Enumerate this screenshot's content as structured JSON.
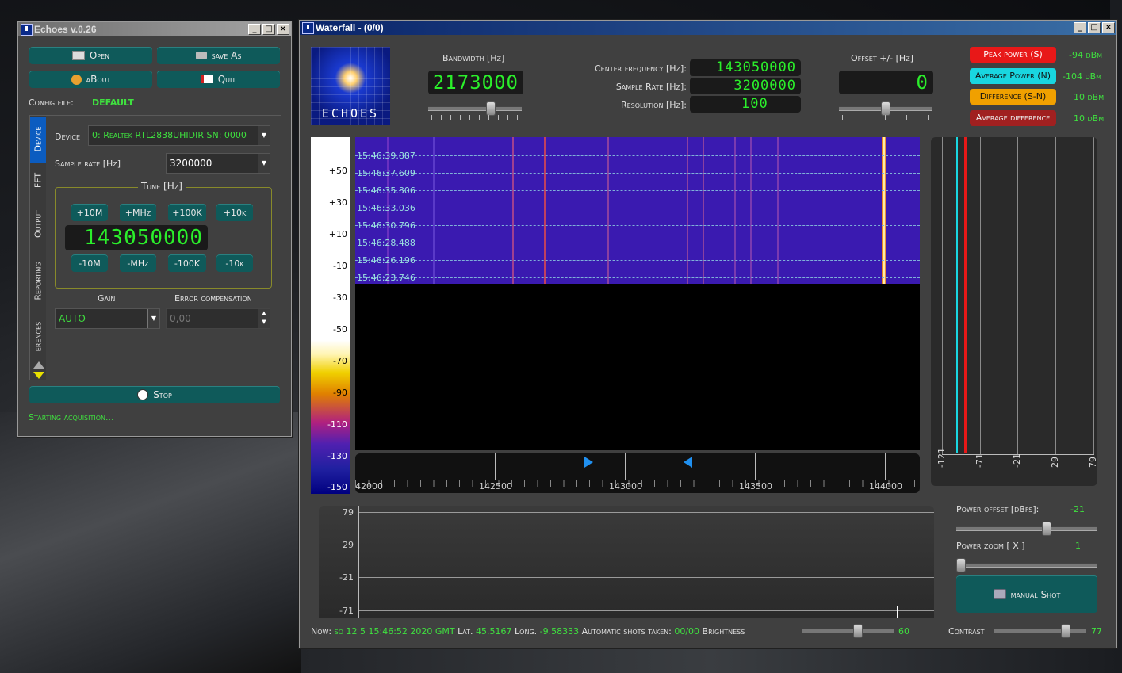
{
  "echoes_window": {
    "title": "Echoes v.0.26",
    "buttons": {
      "open": "Open",
      "save_as": "save As",
      "about": "aBout",
      "quit": "Quit",
      "stop": "Stop"
    },
    "config_label": "Config file:",
    "config_value": "DEFAULT",
    "tabs": [
      "Device",
      "FFT",
      "Output",
      "Reporting",
      "erences"
    ],
    "device_label": "Device",
    "device_value": "0: Realtek RTL2838UHIDIR  SN: 0000",
    "sample_rate_label": "Sample rate [Hz]",
    "sample_rate_value": "3200000",
    "tune_label": "Tune [Hz]",
    "tune_buttons_up": [
      "+10M",
      "+MHz",
      "+100K",
      "+10k"
    ],
    "tune_value": "143050000",
    "tune_buttons_down": [
      "-10M",
      "-MHz",
      "-100K",
      "-10k"
    ],
    "gain_label": "Gain",
    "gain_value": "AUTO",
    "error_comp_label": "Error compensation",
    "error_comp_value": "0,00",
    "status": "Starting acquisition..."
  },
  "waterfall_window": {
    "title": "Waterfall - (0/0)",
    "logo_text": "ECHOES",
    "bandwidth_label": "Bandwidth [Hz]",
    "bandwidth_value": "2173000",
    "center_freq_label": "Center frequency [Hz]:",
    "center_freq_value": "143050000",
    "sample_rate_label": "Sample Rate [Hz]:",
    "sample_rate_value": "3200000",
    "resolution_label": "Resolution [Hz]:",
    "resolution_value": "100",
    "offset_label": "Offset +/- [Hz]",
    "offset_value": "0",
    "legend": [
      {
        "label": "Peak power (S)",
        "value": "-94 dBm",
        "color": "#e81818"
      },
      {
        "label": "Average Power (N)",
        "value": "-104 dBm",
        "color": "#19d6e0"
      },
      {
        "label": "Difference (S-N)",
        "value": "10 dBm",
        "color": "#f0a000"
      },
      {
        "label": "Average difference",
        "value": "10 dBm",
        "color": "#a02020"
      }
    ],
    "color_scale": [
      "+50",
      "+30",
      "+10",
      "-10",
      "-30",
      "-50",
      "-70",
      "-90",
      "-110",
      "-130",
      "-150"
    ],
    "timestamps": [
      "15:46:39.887",
      "15:46:37.609",
      "15:46:35.306",
      "15:46:33.036",
      "15:46:30.796",
      "15:46:28.488",
      "15:46:26.196",
      "15:46:23.746"
    ],
    "freq_axis": [
      "42000",
      "142500",
      "143000",
      "143500",
      "144000"
    ],
    "power_axis": [
      "-121",
      "-71",
      "-21",
      "29",
      "79"
    ],
    "history_axis": [
      "79",
      "29",
      "-21",
      "-71"
    ],
    "power_offset_label": "Power offset [dBfs]:",
    "power_offset_value": "-21",
    "power_zoom_label": "Power zoom  [ X ]",
    "power_zoom_value": "1",
    "manual_shot_label": "manual Shot",
    "status_now_label": "Now:",
    "status_now_value": "so 12 5 15:46:52 2020 GMT",
    "lat_label": "Lat.",
    "lat_value": "45.5167",
    "long_label": "Long.",
    "long_value": "-9.58333",
    "shots_label": "Automatic shots taken:",
    "shots_value": "00/00",
    "brightness_label": "Brightness",
    "brightness_value": "60",
    "contrast_label": "Contrast",
    "contrast_value": "77"
  }
}
